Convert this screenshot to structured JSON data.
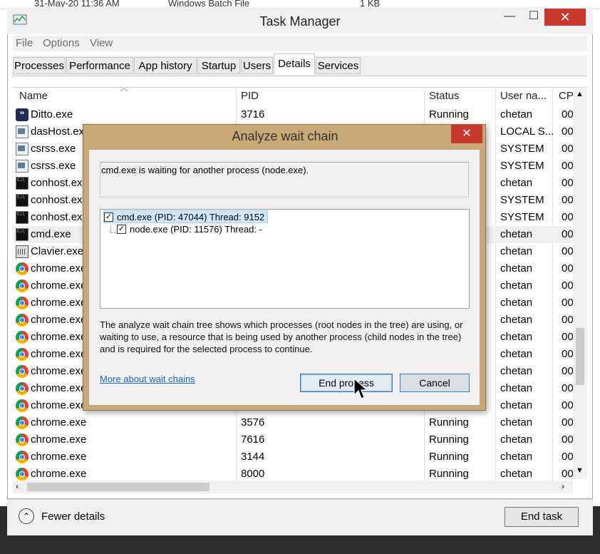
{
  "background": {
    "row": [
      "31-May-20 11:36 AM",
      "Windows Batch File",
      "1 KB"
    ]
  },
  "window": {
    "title": "Task Manager",
    "controls": {
      "minimize": "—",
      "maximize": "☐",
      "close": "✕"
    }
  },
  "menu": [
    "File",
    "Options",
    "View"
  ],
  "tabs": [
    "Processes",
    "Performance",
    "App history",
    "Startup",
    "Users",
    "Details",
    "Services"
  ],
  "active_tab": "Details",
  "columns": [
    "Name",
    "PID",
    "Status",
    "User na...",
    "CPU"
  ],
  "rows": [
    {
      "name": "Ditto.exe",
      "pid": "3716",
      "status": "Running",
      "user": "chetan",
      "cpu": "00",
      "icon": "ditto-icon"
    },
    {
      "name": "dasHost.exe",
      "pid": "",
      "status": "",
      "user": "LOCAL S...",
      "cpu": "00",
      "icon": "window-icon"
    },
    {
      "name": "csrss.exe",
      "pid": "",
      "status": "",
      "user": "SYSTEM",
      "cpu": "00",
      "icon": "window-icon"
    },
    {
      "name": "csrss.exe",
      "pid": "",
      "status": "",
      "user": "SYSTEM",
      "cpu": "00",
      "icon": "window-icon"
    },
    {
      "name": "conhost.exe",
      "pid": "",
      "status": "",
      "user": "chetan",
      "cpu": "00",
      "icon": "console-icon"
    },
    {
      "name": "conhost.exe",
      "pid": "",
      "status": "",
      "user": "SYSTEM",
      "cpu": "00",
      "icon": "console-icon"
    },
    {
      "name": "conhost.exe",
      "pid": "",
      "status": "",
      "user": "SYSTEM",
      "cpu": "00",
      "icon": "console-icon"
    },
    {
      "name": "cmd.exe",
      "pid": "",
      "status": "",
      "user": "chetan",
      "cpu": "00",
      "icon": "console-icon"
    },
    {
      "name": "Clavier.exe",
      "pid": "",
      "status": "",
      "user": "chetan",
      "cpu": "00",
      "icon": "keyboard-icon"
    },
    {
      "name": "chrome.exe",
      "pid": "",
      "status": "",
      "user": "chetan",
      "cpu": "00",
      "icon": "chrome-icon"
    },
    {
      "name": "chrome.exe",
      "pid": "",
      "status": "",
      "user": "chetan",
      "cpu": "00",
      "icon": "chrome-icon"
    },
    {
      "name": "chrome.exe",
      "pid": "",
      "status": "",
      "user": "chetan",
      "cpu": "00",
      "icon": "chrome-icon"
    },
    {
      "name": "chrome.exe",
      "pid": "",
      "status": "",
      "user": "chetan",
      "cpu": "00",
      "icon": "chrome-icon"
    },
    {
      "name": "chrome.exe",
      "pid": "",
      "status": "",
      "user": "chetan",
      "cpu": "00",
      "icon": "chrome-icon"
    },
    {
      "name": "chrome.exe",
      "pid": "",
      "status": "",
      "user": "chetan",
      "cpu": "00",
      "icon": "chrome-icon"
    },
    {
      "name": "chrome.exe",
      "pid": "",
      "status": "",
      "user": "chetan",
      "cpu": "00",
      "icon": "chrome-icon"
    },
    {
      "name": "chrome.exe",
      "pid": "",
      "status": "",
      "user": "chetan",
      "cpu": "00",
      "icon": "chrome-icon"
    },
    {
      "name": "chrome.exe",
      "pid": "",
      "status": "",
      "user": "chetan",
      "cpu": "00",
      "icon": "chrome-icon"
    },
    {
      "name": "chrome.exe",
      "pid": "3576",
      "status": "Running",
      "user": "chetan",
      "cpu": "00",
      "icon": "chrome-icon"
    },
    {
      "name": "chrome.exe",
      "pid": "7616",
      "status": "Running",
      "user": "chetan",
      "cpu": "00",
      "icon": "chrome-icon"
    },
    {
      "name": "chrome.exe",
      "pid": "3144",
      "status": "Running",
      "user": "chetan",
      "cpu": "00",
      "icon": "chrome-icon"
    },
    {
      "name": "chrome.exe",
      "pid": "8000",
      "status": "Running",
      "user": "chetan",
      "cpu": "00",
      "icon": "chrome-icon"
    }
  ],
  "footer": {
    "fewer_details_label": "Fewer details",
    "end_task_label": "End task"
  },
  "dialog": {
    "title": "Analyze wait chain",
    "message": "cmd.exe is waiting for another process (node.exe).",
    "tree": [
      {
        "label": "cmd.exe (PID: 47044) Thread: 9152",
        "checked": true,
        "selected": true
      },
      {
        "label": "node.exe (PID: 11576) Thread: -",
        "checked": true,
        "selected": false
      }
    ],
    "description": "The analyze wait chain tree shows which processes (root nodes in the tree) are using, or waiting to use, a resource that is being used by another process (child nodes in the tree) and is required for the selected process to continue.",
    "link": "More about wait chains",
    "end_process_label": "End process",
    "cancel_label": "Cancel",
    "close_glyph": "✕"
  },
  "colors": {
    "dialog_frame": "#c9a978",
    "close_red": "#c7392e",
    "link_blue": "#1a63c9",
    "selection": "#cde8ff"
  }
}
